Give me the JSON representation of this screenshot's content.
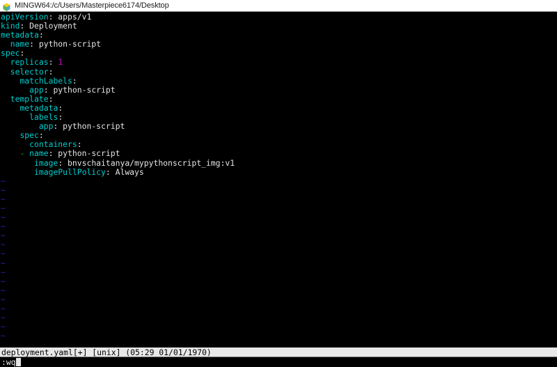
{
  "window": {
    "title": "MINGW64:/c/Users/Masterpiece6174/Desktop",
    "icon": "git-bash-icon"
  },
  "colors": {
    "terminal_background": "#000000",
    "titlebar_background": "#ffffff",
    "key": "#00cdcd",
    "value": "#e5e5e5",
    "number": "#cd00cd",
    "dash": "#00cd00",
    "tilde": "#2222aa",
    "statusline_background": "#e8e8e8",
    "statusline_text": "#000000"
  },
  "editor": {
    "name": "vim",
    "buffer_lines": [
      {
        "indent": 0,
        "key": "apiVersion",
        "value": "apps/v1",
        "type": "pair"
      },
      {
        "indent": 0,
        "key": "kind",
        "value": "Deployment",
        "type": "pair"
      },
      {
        "indent": 0,
        "key": "metadata",
        "value": "",
        "type": "key"
      },
      {
        "indent": 2,
        "key": "name",
        "value": "python-script",
        "type": "pair"
      },
      {
        "indent": 0,
        "key": "spec",
        "value": "",
        "type": "key"
      },
      {
        "indent": 2,
        "key": "replicas",
        "value": "1",
        "type": "number"
      },
      {
        "indent": 2,
        "key": "selector",
        "value": "",
        "type": "key"
      },
      {
        "indent": 4,
        "key": "matchLabels",
        "value": "",
        "type": "key"
      },
      {
        "indent": 6,
        "key": "app",
        "value": "python-script",
        "type": "pair"
      },
      {
        "indent": 2,
        "key": "template",
        "value": "",
        "type": "key"
      },
      {
        "indent": 4,
        "key": "metadata",
        "value": "",
        "type": "key"
      },
      {
        "indent": 6,
        "key": "labels",
        "value": "",
        "type": "key"
      },
      {
        "indent": 8,
        "key": "app",
        "value": "python-script",
        "type": "pair"
      },
      {
        "indent": 4,
        "key": "spec",
        "value": "",
        "type": "key"
      },
      {
        "indent": 6,
        "key": "containers",
        "value": "",
        "type": "key"
      },
      {
        "indent": 4,
        "key": "name",
        "value": "python-script",
        "type": "item"
      },
      {
        "indent": 7,
        "key": "image",
        "value": "bnvschaitanya/mypythonscript_img:v1",
        "type": "pair"
      },
      {
        "indent": 7,
        "key": "imagePullPolicy",
        "value": "Always",
        "type": "pair"
      }
    ],
    "empty_marker": "~",
    "empty_line_count": 18,
    "statusline": "deployment.yaml[+] [unix] (05:29 01/01/1970)",
    "statusline_parts": {
      "filename": "deployment.yaml",
      "modified_flag": "[+]",
      "fileformat": "[unix]",
      "timestamp": "(05:29 01/01/1970)"
    },
    "command_line": ":wq",
    "cursor": "block"
  }
}
